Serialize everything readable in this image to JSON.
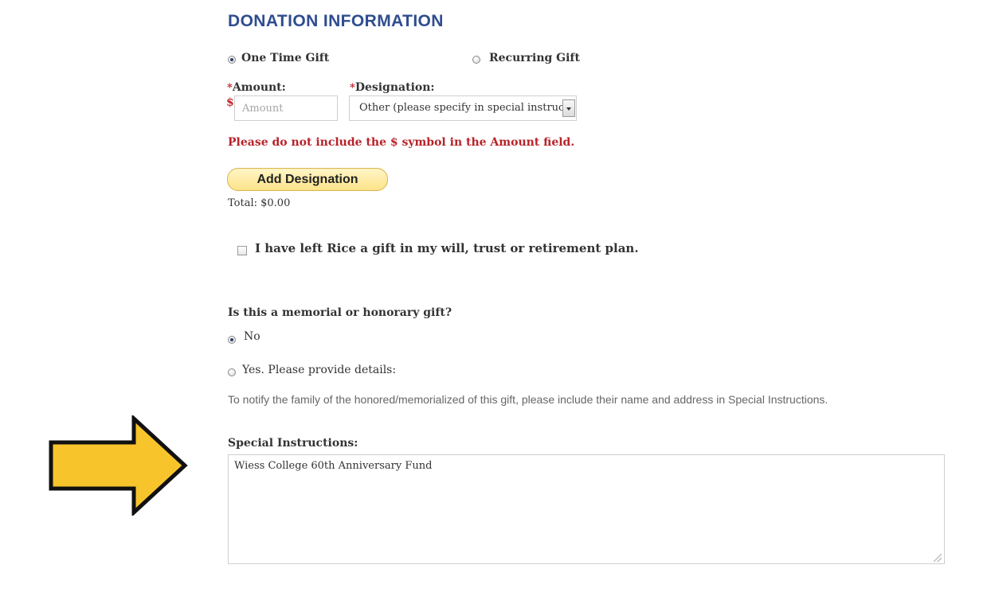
{
  "section_title": "DONATION INFORMATION",
  "gift_type": {
    "one_time_label": "One Time Gift",
    "recurring_label": "Recurring Gift",
    "selected": "one_time"
  },
  "amount": {
    "required_mark": "*",
    "label": "Amount:",
    "currency_symbol": "$",
    "placeholder": "Amount",
    "value": ""
  },
  "designation": {
    "required_mark": "*",
    "label": "Designation:",
    "selected_value": "Other (please specify in special instructions)"
  },
  "warning_text": "Please do not include the $ symbol in the Amount field.",
  "add_designation_label": "Add Designation",
  "total_text": "Total: $0.00",
  "will_gift": {
    "label": "I have left Rice a gift in my will, trust or retirement plan.",
    "checked": false
  },
  "memorial": {
    "question": "Is this a memorial or honorary gift?",
    "options": [
      {
        "label": "No",
        "selected": true
      },
      {
        "label": "Yes. Please provide details:",
        "selected": false
      }
    ],
    "notice": "To notify the family of the honored/memorialized of this gift, please include their name and address in Special Instructions."
  },
  "special_instructions": {
    "label": "Special Instructions:",
    "value": "Wiess College 60th Anniversary Fund"
  },
  "colors": {
    "title": "#2f4d8f",
    "warning": "#b8232a",
    "button": "#fde48a",
    "arrow": "#f7c52b"
  },
  "icons": [
    "arrow-right-icon",
    "chevron-down-icon",
    "resize-grip-icon"
  ]
}
